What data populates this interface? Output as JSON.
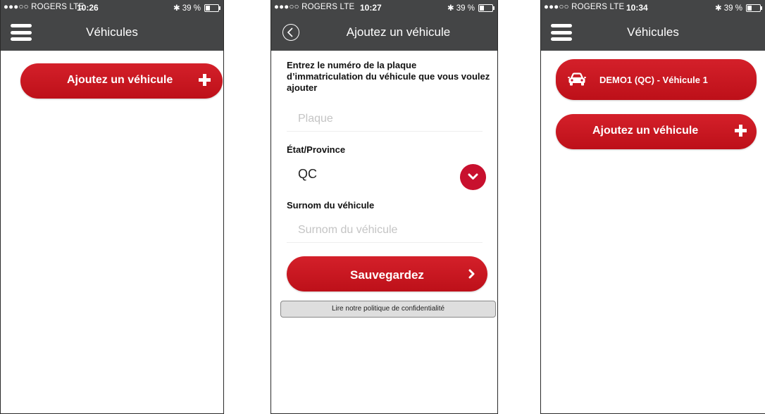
{
  "status": {
    "carrier": "●●●○○ ROGERS  LTE",
    "bluetooth_battery": "✱ 39 %"
  },
  "screen1": {
    "time": "10:26",
    "title": "Véhicules",
    "add_vehicle_label": "Ajoutez un véhicule"
  },
  "screen2": {
    "time": "10:27",
    "title": "Ajoutez un véhicule",
    "heading": "Entrez le numéro de la plaque d’immatriculation du véhicule que vous voulez ajouter",
    "plate_placeholder": "Plaque",
    "plate_value": "",
    "state_label": "État/Province",
    "state_value": "QC",
    "nickname_label": "Surnom du véhicule",
    "nickname_placeholder": "Surnom du véhicule",
    "nickname_value": "",
    "save_label": "Sauvegardez",
    "privacy_label": "Lire notre politique de confidentialité"
  },
  "screen3": {
    "time": "10:34",
    "title": "Véhicules",
    "vehicle_label": "DEMO1 (QC) - Véhicule 1",
    "add_vehicle_label": "Ajoutez un véhicule"
  },
  "icons": {
    "menu": "hamburger-icon",
    "back": "back-chevron-icon",
    "plus": "plus-icon",
    "chevron_down": "chevron-down-icon",
    "chevron_right": "chevron-right-icon",
    "car": "car-icon",
    "battery": "battery-icon"
  },
  "colors": {
    "header": "#444546",
    "accent": "#c8102e",
    "background": "#ffffff"
  }
}
